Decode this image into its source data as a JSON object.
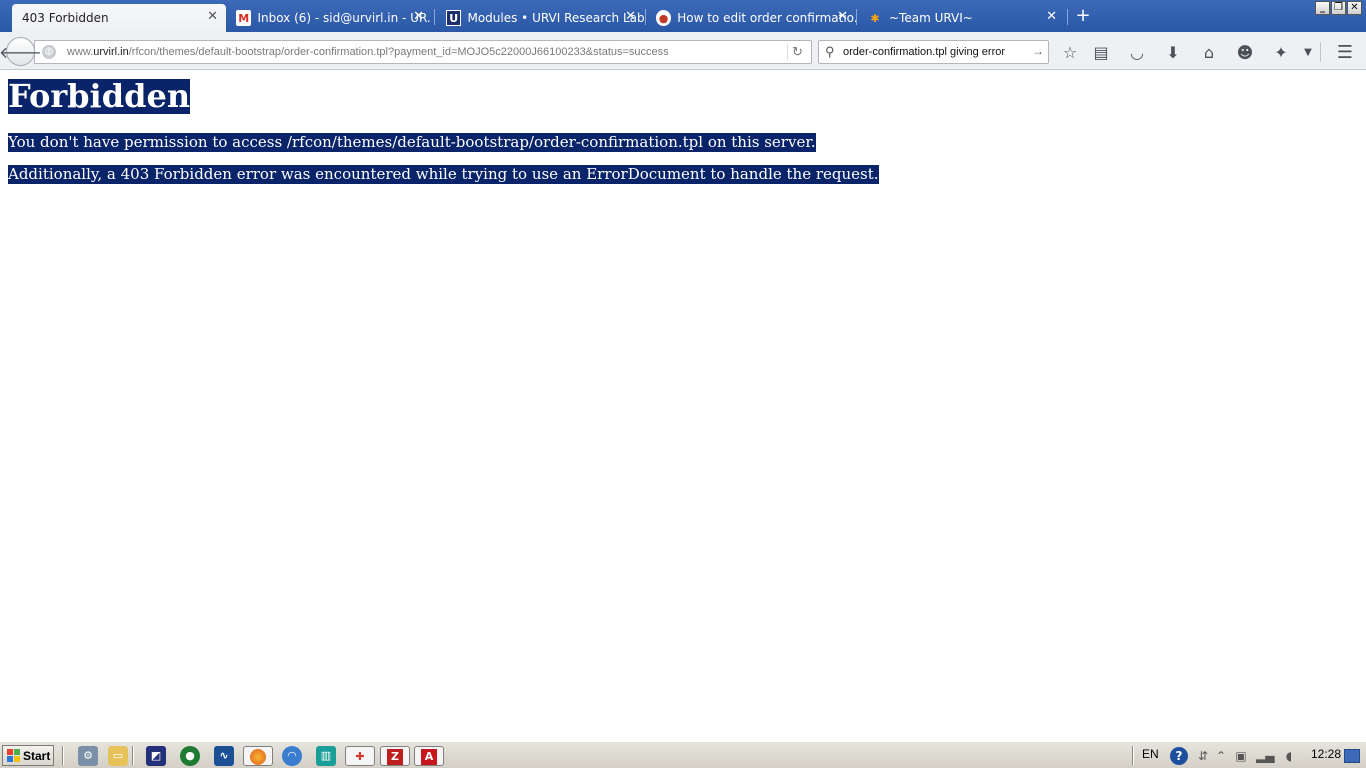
{
  "window": {
    "tabs": [
      {
        "title": "403 Forbidden",
        "favicon": "none",
        "active": true
      },
      {
        "title": "Inbox (6) - sid@urvirl.in - UR...",
        "favicon": "gmail-icon",
        "active": false
      },
      {
        "title": "Modules • URVI Research Labs",
        "favicon": "u-logo-icon",
        "active": false
      },
      {
        "title": "How to edit order confirmatio...",
        "favicon": "forum-icon",
        "active": false
      },
      {
        "title": "~Team URVI~",
        "favicon": "joomla-icon",
        "active": false
      }
    ],
    "new_tab_glyph": "+",
    "controls": {
      "minimize": "_",
      "restore": "❐",
      "close": "✕"
    }
  },
  "navbar": {
    "url_prefix": "www.",
    "url_domain": "urvirl.in",
    "url_path": "/rfcon/themes/default-bootstrap/order-confirmation.tpl?payment_id=MOJO5c22000J66100233&status=success",
    "search_value": "order-confirmation.tpl giving error"
  },
  "page": {
    "heading": "Forbidden",
    "message1": "You don't have permission to access /rfcon/themes/default-bootstrap/order-confirmation.tpl on this server.",
    "message2": "Additionally, a 403 Forbidden error was encountered while trying to use an ErrorDocument to handle the request.",
    "selection_color": "#0a246a"
  },
  "taskbar": {
    "start_label": "Start",
    "language": "EN",
    "clock": "12:28"
  }
}
